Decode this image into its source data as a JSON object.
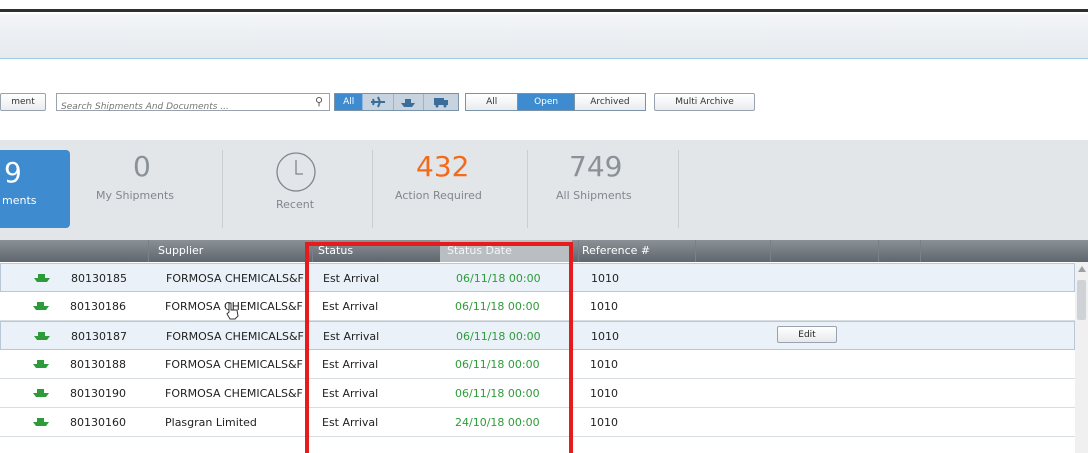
{
  "toolbar": {
    "left_button": "ment",
    "search_placeholder": "Search Shipments And Documents ...",
    "mode_all": "All",
    "filter_all": "All",
    "filter_open": "Open",
    "filter_archived": "Archived",
    "multi_archive": "Multi Archive"
  },
  "stats": {
    "active": {
      "number": "9",
      "label": "ments"
    },
    "my": {
      "number": "0",
      "label": "My Shipments"
    },
    "recent": {
      "label": "Recent"
    },
    "action": {
      "number": "432",
      "label": "Action Required"
    },
    "all": {
      "number": "749",
      "label": "All Shipments"
    }
  },
  "columns": {
    "supplier": "Supplier",
    "status": "Status",
    "status_date": "Status Date",
    "reference": "Reference #"
  },
  "rows": [
    {
      "id": "80130185",
      "supplier": "FORMOSA CHEMICALS&F",
      "status": "Est Arrival",
      "date": "06/11/18 00:00",
      "ref": "1010"
    },
    {
      "id": "80130186",
      "supplier": "FORMOSA CHEMICALS&F",
      "status": "Est Arrival",
      "date": "06/11/18 00:00",
      "ref": "1010"
    },
    {
      "id": "80130187",
      "supplier": "FORMOSA CHEMICALS&F",
      "status": "Est Arrival",
      "date": "06/11/18 00:00",
      "ref": "1010",
      "action": "Edit"
    },
    {
      "id": "80130188",
      "supplier": "FORMOSA CHEMICALS&F",
      "status": "Est Arrival",
      "date": "06/11/18 00:00",
      "ref": "1010"
    },
    {
      "id": "80130190",
      "supplier": "FORMOSA CHEMICALS&F",
      "status": "Est Arrival",
      "date": "06/11/18 00:00",
      "ref": "1010"
    },
    {
      "id": "80130160",
      "supplier": "Plasgran Limited",
      "status": "Est Arrival",
      "date": "24/10/18 00:00",
      "ref": "1010"
    }
  ],
  "colors": {
    "accent": "#3e8ccf",
    "action_required": "#f26b1d",
    "date_green": "#2e9b3a",
    "highlight": "#e61c1c"
  }
}
